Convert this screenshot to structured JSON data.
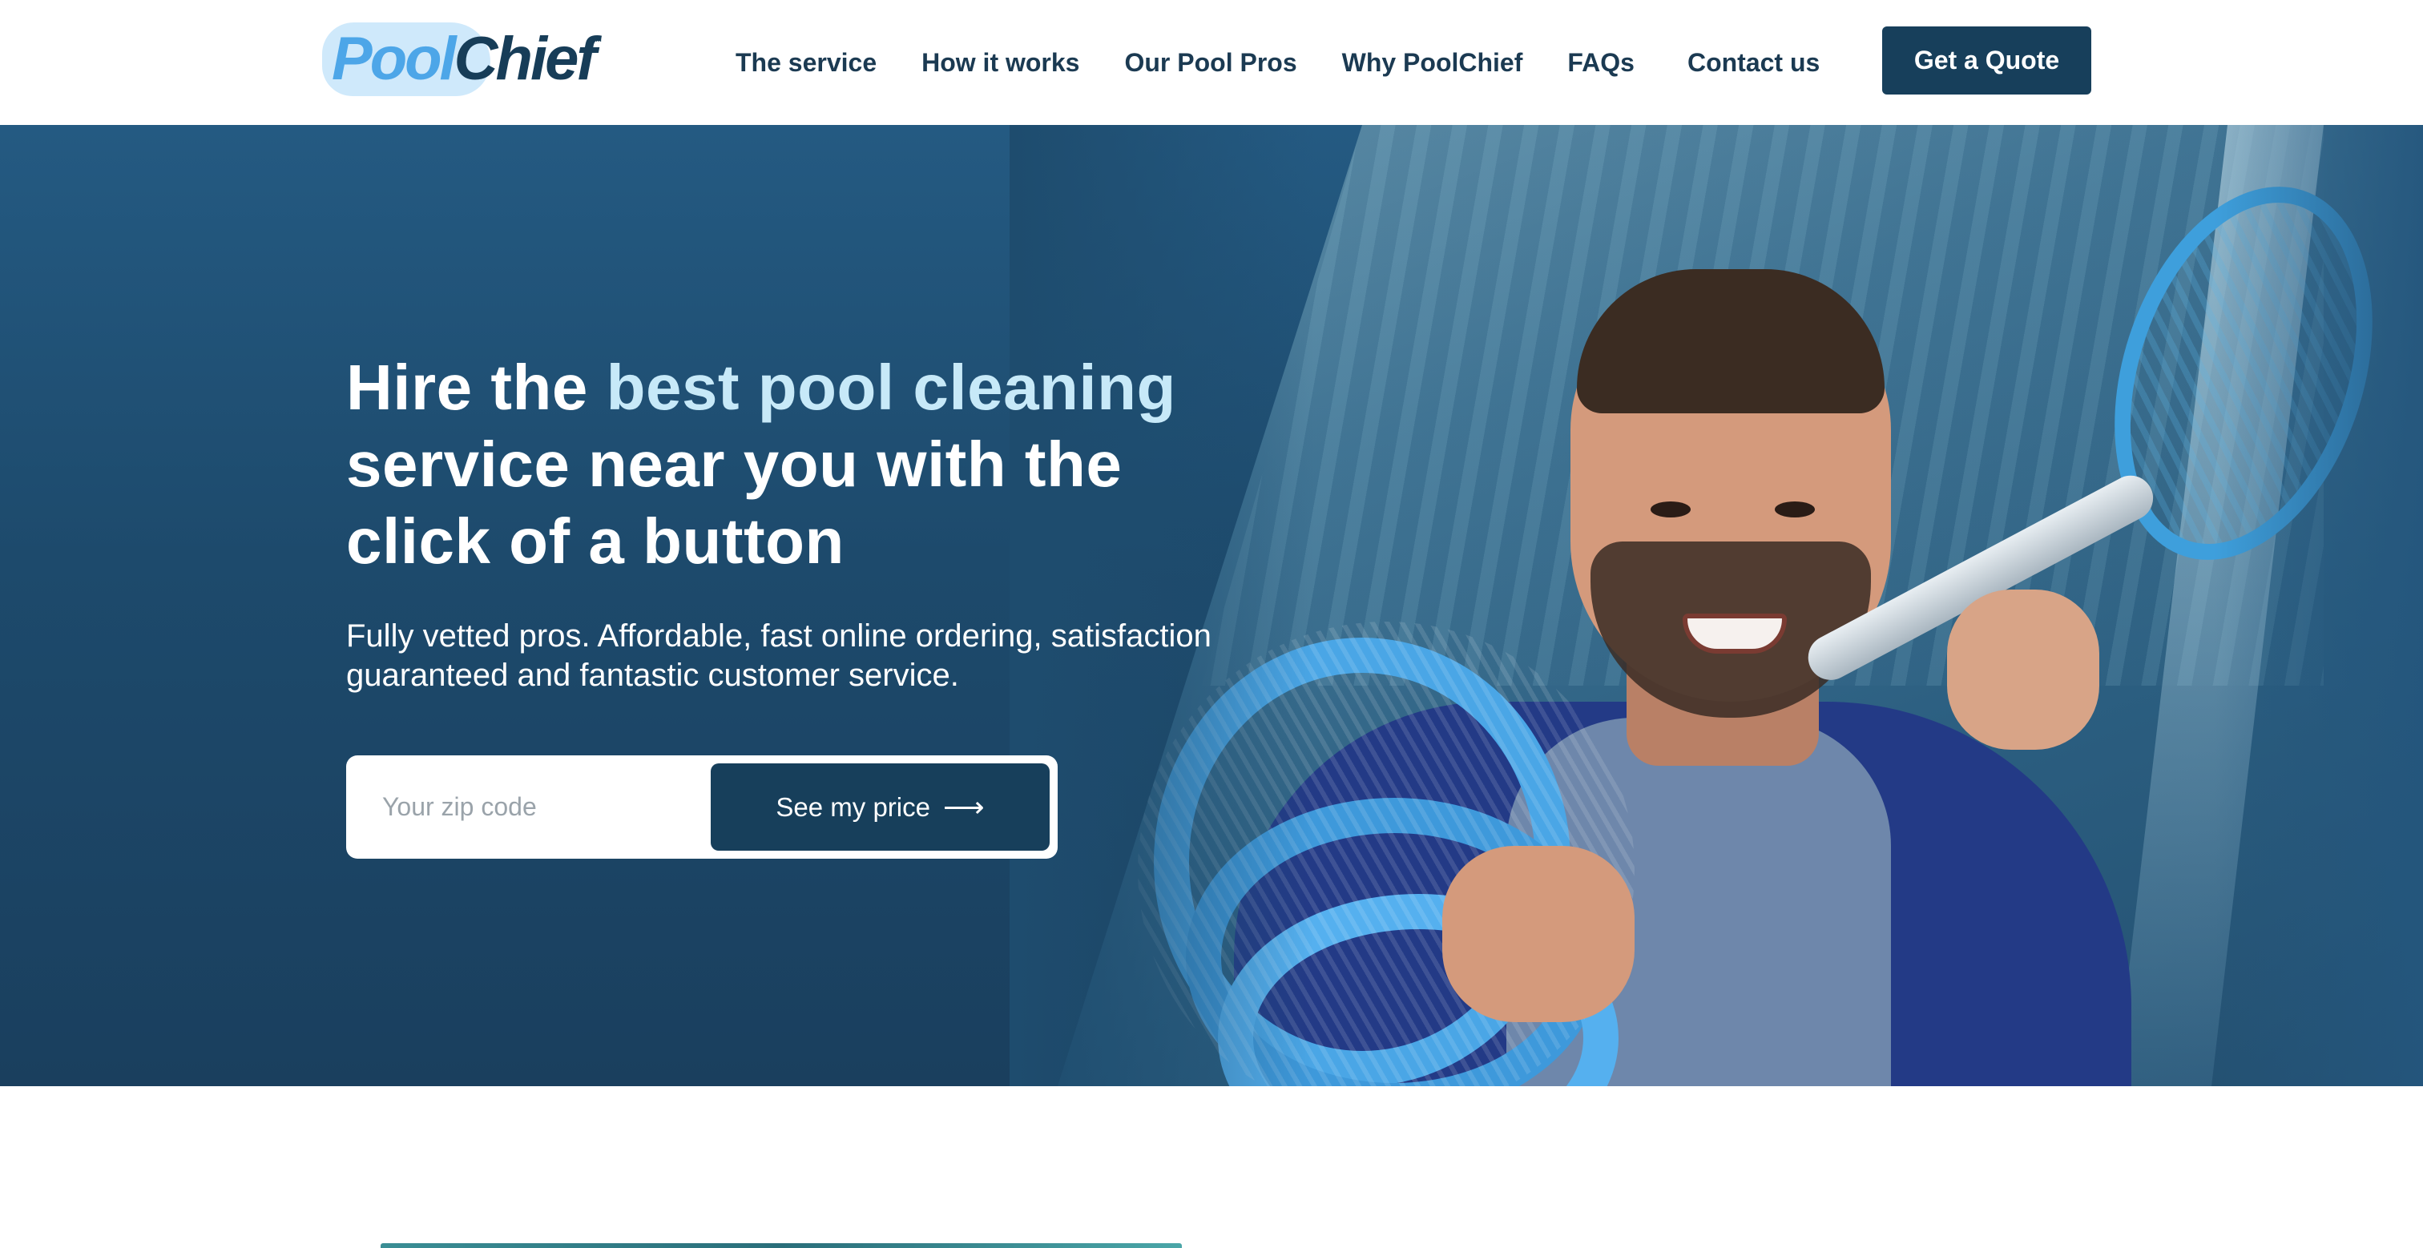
{
  "brand": {
    "logo_pool": "Pool",
    "logo_chief": "Chief",
    "logo_tm": "™",
    "colors": {
      "primary": "#173f5b",
      "accent": "#c7e9f8",
      "logo_blue": "#4da6e8"
    }
  },
  "nav": {
    "items": [
      {
        "label": "The service"
      },
      {
        "label": "How it works"
      },
      {
        "label": "Our Pool Pros"
      },
      {
        "label": "Why PoolChief"
      },
      {
        "label": "FAQs"
      },
      {
        "label": "Contact us"
      }
    ],
    "cta_label": "Get a Quote"
  },
  "hero": {
    "title_part1": "Hire the ",
    "title_accent": "best pool cleaning",
    "title_part2": " service near you with the click of a button",
    "subtitle": "Fully vetted pros. Affordable, fast online ordering, satisfaction guaranteed and fantastic customer service.",
    "zip_placeholder": "Your zip code",
    "zip_value": "",
    "submit_label": "See my price",
    "submit_icon": "arrow-right-icon"
  }
}
